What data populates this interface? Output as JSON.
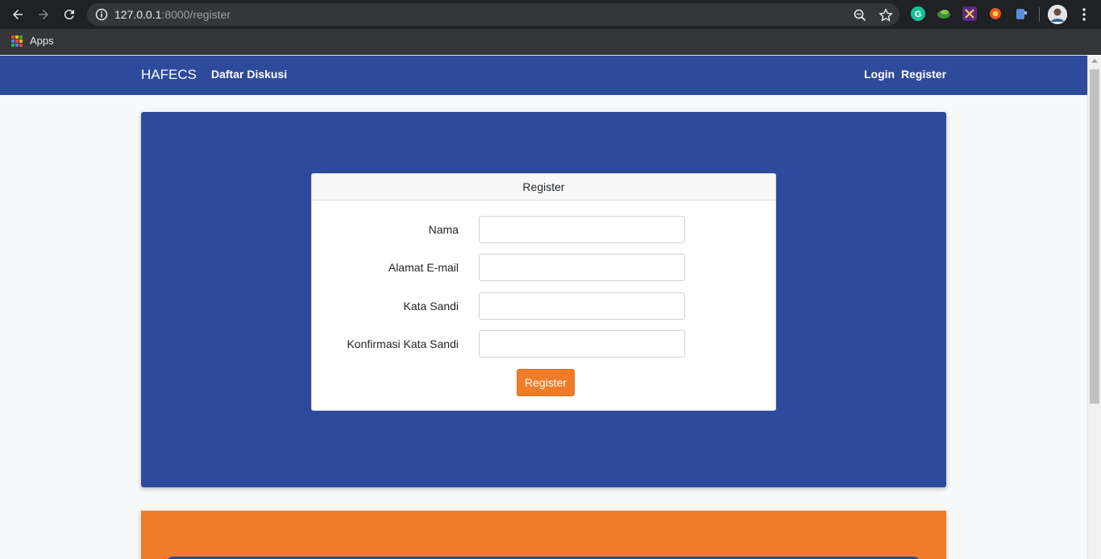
{
  "browser": {
    "url_host": "127.0.0.1",
    "url_rest": ":8000/register",
    "bookmarks": {
      "apps_label": "Apps"
    },
    "icons": [
      "back-icon",
      "forward-icon",
      "reload-icon",
      "info-icon",
      "zoom-icon",
      "star-icon",
      "grammarly-icon",
      "extension-icon",
      "extension-icon",
      "extension-icon",
      "extension-icon",
      "profile-avatar",
      "menu-icon"
    ]
  },
  "navbar": {
    "brand": "HAFECS",
    "links": {
      "discussions": "Daftar Diskusi",
      "login": "Login",
      "register": "Register"
    },
    "color": "#2e4a9c"
  },
  "register_form": {
    "title": "Register",
    "fields": {
      "name": {
        "label": "Nama",
        "value": ""
      },
      "email": {
        "label": "Alamat E-mail",
        "value": ""
      },
      "password": {
        "label": "Kata Sandi",
        "value": ""
      },
      "password_confirm": {
        "label": "Konfirmasi Kata Sandi",
        "value": ""
      }
    },
    "submit_label": "Register"
  },
  "colors": {
    "primary": "#2e4a9c",
    "accent": "#f07c27"
  }
}
